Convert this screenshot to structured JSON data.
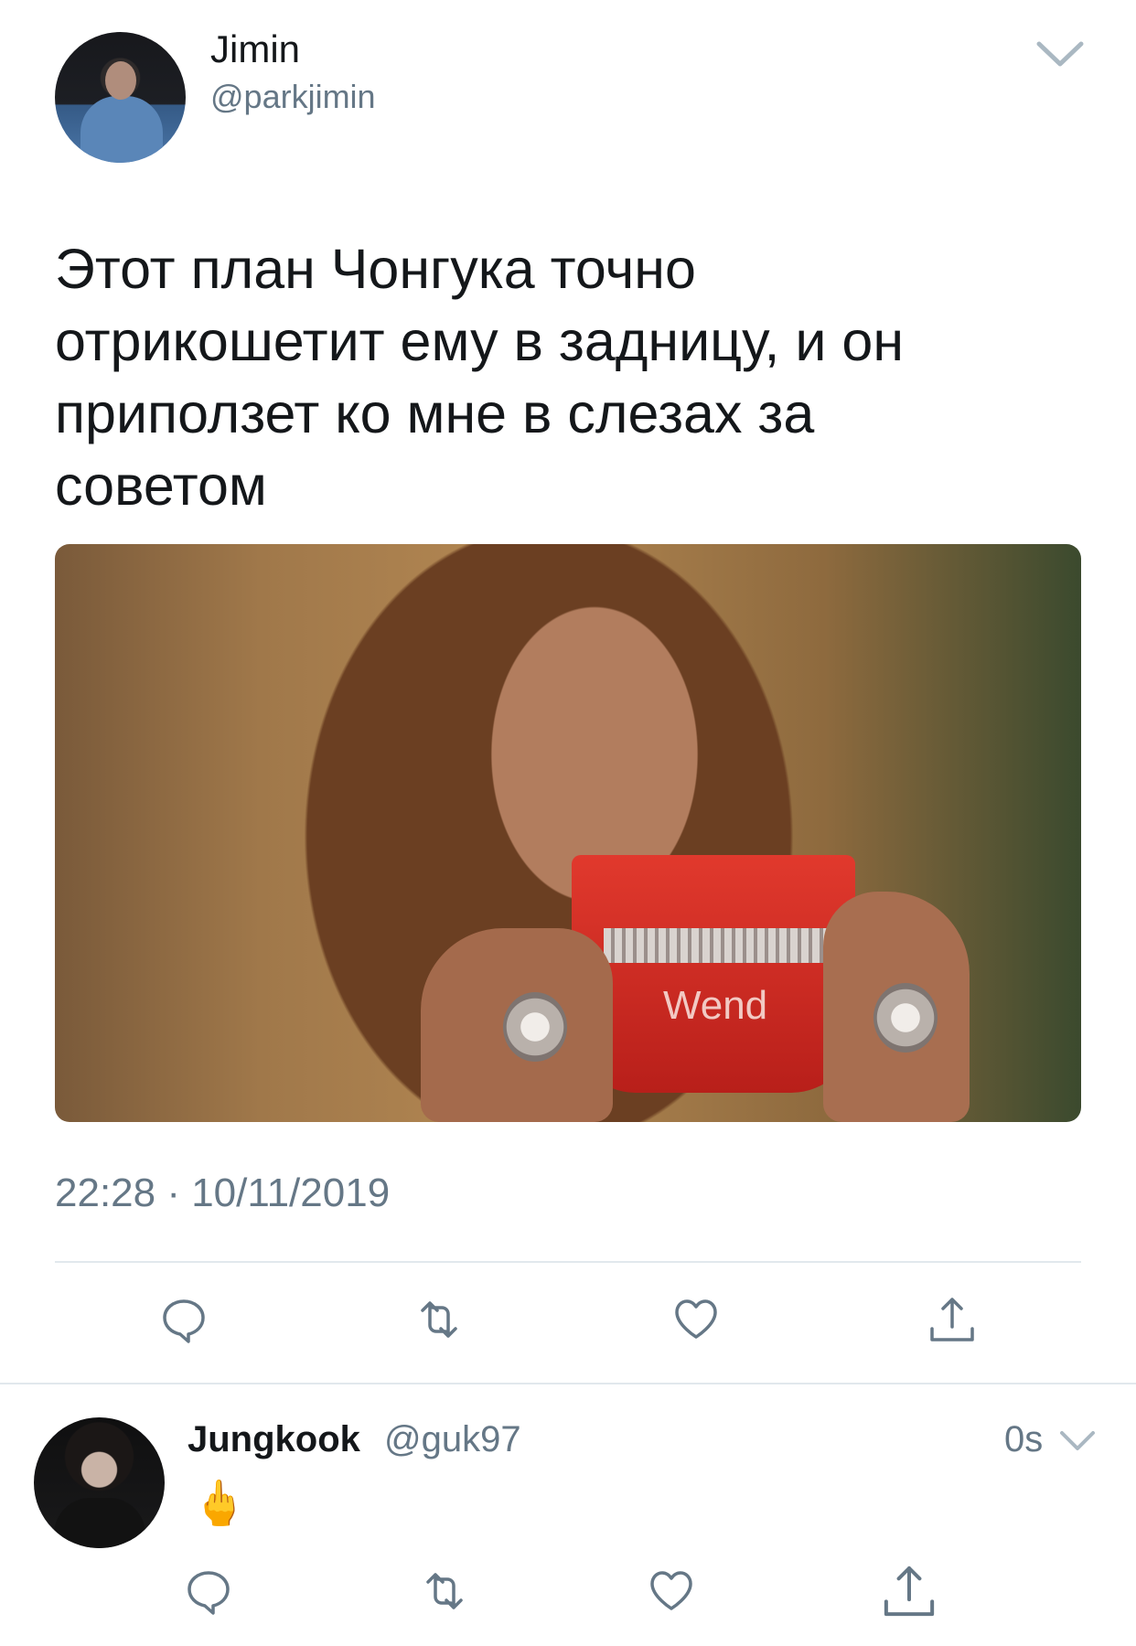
{
  "tweet": {
    "author_name": "Jimin",
    "author_handle": "@parkjimin",
    "text": "Этот план Чонгука точно отрикошетит ему в задницу, и он приползет ко мне в слезах за советом",
    "media_mug_text": "Wend",
    "timestamp": "22:28 · 10/11/2019",
    "actions": [
      "reply-icon",
      "retweet-icon",
      "like-icon",
      "share-icon"
    ]
  },
  "reply": {
    "author_name": "Jungkook",
    "author_handle": "@guk97",
    "time": "0s",
    "text": "🖕",
    "actions": [
      "reply-icon",
      "retweet-icon",
      "like-icon",
      "share-icon"
    ]
  },
  "colors": {
    "text": "#14171a",
    "secondary": "#657786",
    "icon": "#657786",
    "divider": "#e1e8ed"
  }
}
